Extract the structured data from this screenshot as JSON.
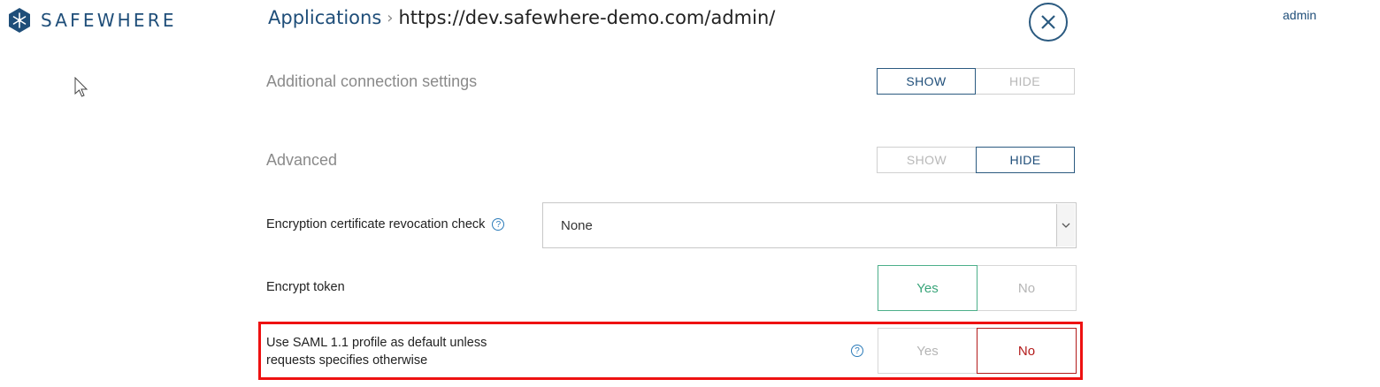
{
  "brand": {
    "name": "SAFEWHERE"
  },
  "header": {
    "breadcrumb_parent": "Applications",
    "breadcrumb_separator": "›",
    "breadcrumb_current": "https://dev.safewhere-demo.com/admin/",
    "user": "admin"
  },
  "sections": {
    "additional": {
      "title": "Additional connection settings",
      "show": "SHOW",
      "hide": "HIDE",
      "selected": "SHOW"
    },
    "advanced": {
      "title": "Advanced",
      "show": "SHOW",
      "hide": "HIDE",
      "selected": "HIDE"
    }
  },
  "fields": {
    "revocation": {
      "label": "Encryption certificate revocation check",
      "value": "None"
    },
    "encrypt_token": {
      "label": "Encrypt token",
      "yes": "Yes",
      "no": "No",
      "selected": "Yes"
    },
    "saml11": {
      "label_line1": "Use SAML 1.1 profile as default unless",
      "label_line2": "requests specifies otherwise",
      "yes": "Yes",
      "no": "No",
      "selected": "No"
    }
  },
  "help_glyph": "?",
  "colors": {
    "brand": "#1f4e79",
    "yes_active": "#3aa57a",
    "no_active": "#b31b1b",
    "highlight": "#ee1111"
  }
}
